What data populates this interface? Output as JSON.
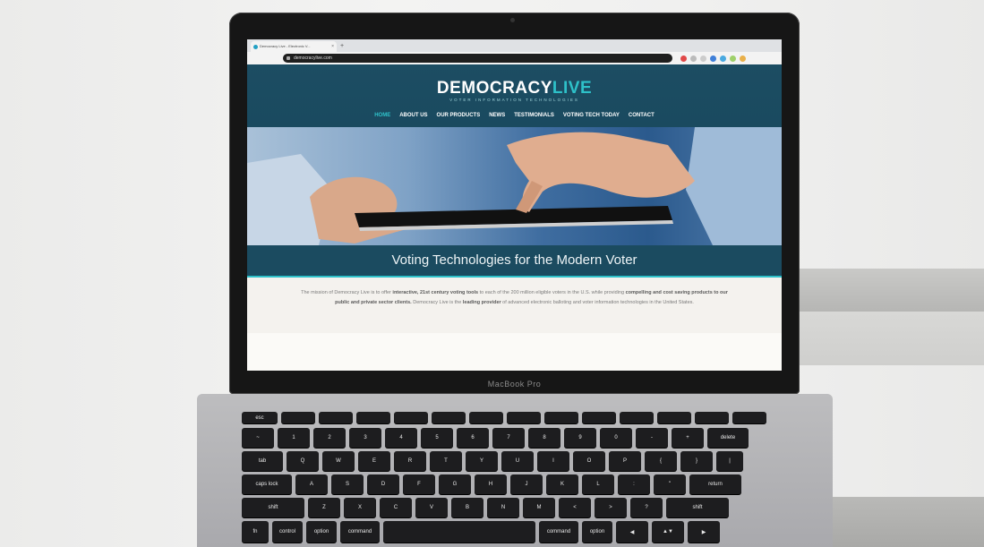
{
  "browser": {
    "tab_title": "Democracy Live - Electronic V...",
    "tab_close": "×",
    "new_tab": "+",
    "url": "democracylive.com"
  },
  "site": {
    "logo_main": "DEMOCRACY",
    "logo_live": "LIVE",
    "logo_tagline": "VOTER INFORMATION TECHNOLOGIES",
    "nav": [
      "HOME",
      "ABOUT US",
      "OUR PRODUCTS",
      "NEWS",
      "TESTIMONIALS",
      "VOTING TECH TODAY",
      "CONTACT"
    ],
    "active_nav": "HOME",
    "hero_title": "Voting Technologies for the Modern Voter",
    "mission_part1": "The mission of Democracy Live is to offer ",
    "mission_bold1": "interactive, 21st century voting tools",
    "mission_part2": " to each of the 200 million eligible voters in the U.S. while providing ",
    "mission_bold2": "compelling and cost saving products to our public and private sector clients.",
    "mission_part3": " Democracy Live is the ",
    "mission_bold3": "leading provider",
    "mission_part4": " of advanced electronic balloting and voter information technologies in the United States."
  },
  "laptop": {
    "model_label": "MacBook Pro"
  },
  "keyboard": {
    "row1": [
      "esc",
      "",
      "",
      "",
      "",
      "",
      "",
      "",
      "",
      "",
      "",
      "",
      "",
      ""
    ],
    "row2": [
      "~",
      "1",
      "2",
      "3",
      "4",
      "5",
      "6",
      "7",
      "8",
      "9",
      "0",
      "-",
      "+",
      "delete"
    ],
    "row3": [
      "tab",
      "Q",
      "W",
      "E",
      "R",
      "T",
      "Y",
      "U",
      "I",
      "O",
      "P",
      "{",
      "}",
      "|"
    ],
    "row4": [
      "caps lock",
      "A",
      "S",
      "D",
      "F",
      "G",
      "H",
      "J",
      "K",
      "L",
      ":",
      "\"",
      "return"
    ],
    "row5": [
      "shift",
      "Z",
      "X",
      "C",
      "V",
      "B",
      "N",
      "M",
      "<",
      ">",
      "?",
      "shift"
    ],
    "row6": [
      "fn",
      "control",
      "option",
      "command",
      "",
      "command",
      "option",
      "◀",
      "▲▼",
      "▶"
    ]
  },
  "colors": {
    "header_bg": "#1c4d63",
    "logo_accent": "#2ec1c9",
    "laptop_bezel": "#161616"
  }
}
